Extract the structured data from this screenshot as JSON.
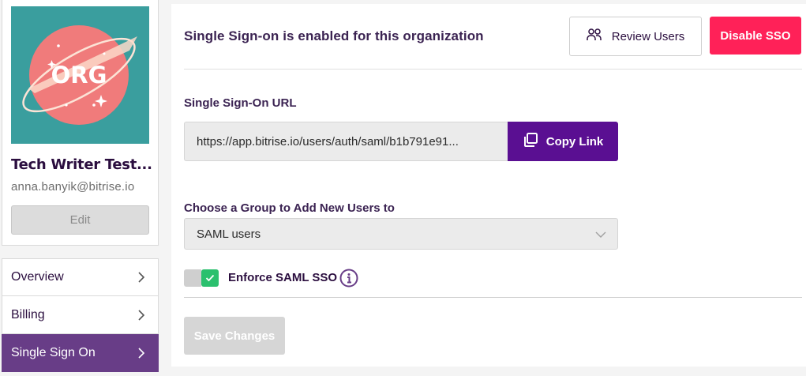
{
  "org": {
    "avatar_text": "ORG",
    "name": "Tech Writer Test...",
    "email": "anna.banyik@bitrise.io",
    "edit_label": "Edit"
  },
  "nav": {
    "items": [
      {
        "label": "Overview",
        "active": false
      },
      {
        "label": "Billing",
        "active": false
      },
      {
        "label": "Single Sign On",
        "active": true
      }
    ]
  },
  "header": {
    "title": "Single Sign-on is enabled for this organization",
    "review_users_label": "Review Users",
    "disable_sso_label": "Disable SSO"
  },
  "sso": {
    "url_label": "Single Sign-On URL",
    "url_value": "https://app.bitrise.io/users/auth/saml/b1b791e91...",
    "copy_label": "Copy Link",
    "group_label": "Choose a Group to Add New Users to",
    "group_selected": "SAML users",
    "enforce_label": "Enforce SAML SSO",
    "enforce_enabled": true,
    "save_label": "Save Changes"
  },
  "colors": {
    "avatar_bg": "#3a9e9e",
    "avatar_circle": "#f07b7b",
    "active_nav": "#683d87",
    "disable_button": "#ff2158",
    "copy_button": "#5a0f92",
    "toggle_on": "#2bc06e"
  },
  "icons": {
    "review_users": "users-icon",
    "copy_link": "copy-icon",
    "select": "chevron-down-icon",
    "nav": "chevron-right-icon",
    "enforce_info": "info-icon"
  }
}
